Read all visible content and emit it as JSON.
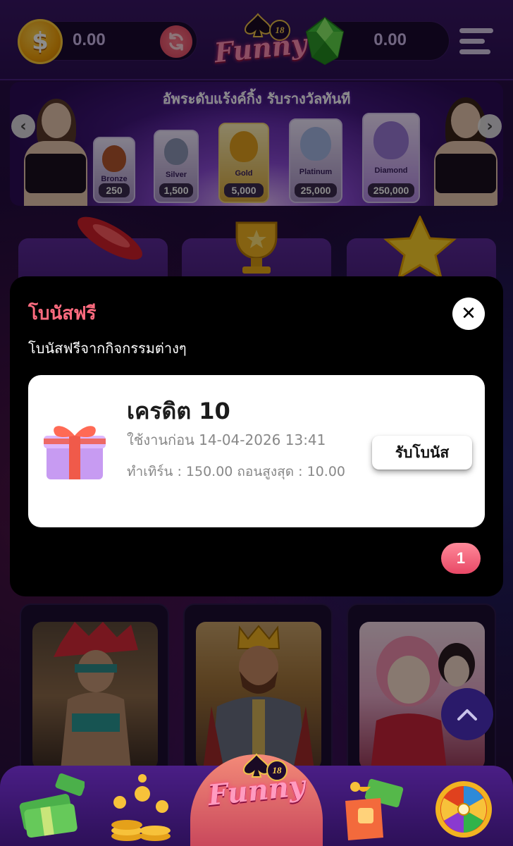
{
  "header": {
    "credit_amount": "0.00",
    "gem_amount": "0.00",
    "logo_text": "Funny",
    "logo_badge": "18"
  },
  "banner": {
    "title": "อัพระดับแร้งค์กิ้ง รับรางวัลทันที",
    "tiers": [
      {
        "name": "Bronze",
        "value": "250",
        "color": "#b5562e"
      },
      {
        "name": "Silver",
        "value": "1,500",
        "color": "#8f97b8"
      },
      {
        "name": "Gold",
        "value": "5,000",
        "color": "#e3a11e"
      },
      {
        "name": "Platinum",
        "value": "25,000",
        "color": "#a7b9e6"
      },
      {
        "name": "Diamond",
        "value": "250,000",
        "color": "#9b7bd8"
      }
    ]
  },
  "modal": {
    "title": "โบนัสฟรี",
    "subtitle": "โบนัสฟรีจากกิจกรรมต่างๆ",
    "close_symbol": "✕",
    "bonus": {
      "title": "เครดิต 10",
      "expire": "ใช้งานก่อน 14-04-2026 13:41",
      "terms": "ทำเทิร์น : 150.00  ถอนสูงสุด : 10.00",
      "claim_label": "รับโบนัส"
    },
    "page_number": "1"
  },
  "bottom_nav": {
    "center_logo_text": "Funny",
    "center_logo_badge": "18"
  },
  "colors": {
    "accent": "#ff6b7f",
    "background": "#1c0b33",
    "modal": "#000000"
  }
}
